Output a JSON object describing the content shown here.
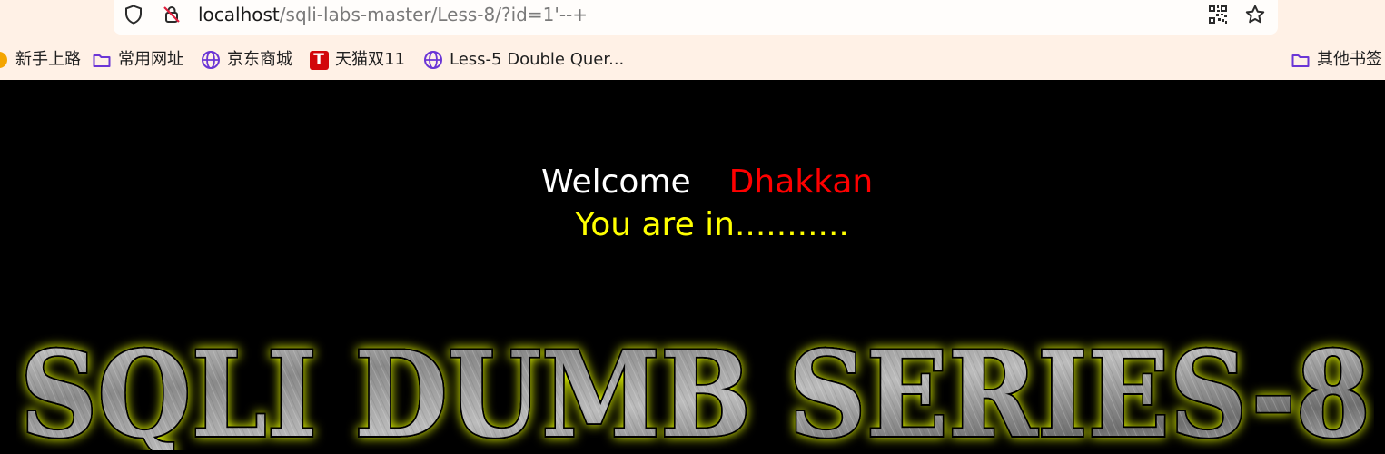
{
  "browser": {
    "url_host": "localhost",
    "url_path": "/sqli-labs-master/Less-8/?id=1'--+",
    "bookmarks": [
      {
        "label": "新手上路",
        "icon": "orange-dot-icon"
      },
      {
        "label": "常用网址",
        "icon": "folder-icon"
      },
      {
        "label": "京东商城",
        "icon": "globe-icon"
      },
      {
        "label": "天猫双11",
        "icon": "tmall-icon",
        "badge": "T"
      },
      {
        "label": "Less-5 Double Quer...",
        "icon": "globe-icon"
      },
      {
        "label": "其他书签",
        "icon": "folder-icon"
      }
    ]
  },
  "page": {
    "welcome": "Welcome",
    "user": "Dhakkan",
    "status": "You are in...........",
    "banner_title": "SQLI DUMB SERIES-8"
  },
  "colors": {
    "background": "#000000",
    "welcome": "#ffffff",
    "user": "#ff0000",
    "status": "#ffff00",
    "banner_glow": "#eaff00",
    "browser_bg": "#fff1e6",
    "accent": "#6b36d6"
  }
}
